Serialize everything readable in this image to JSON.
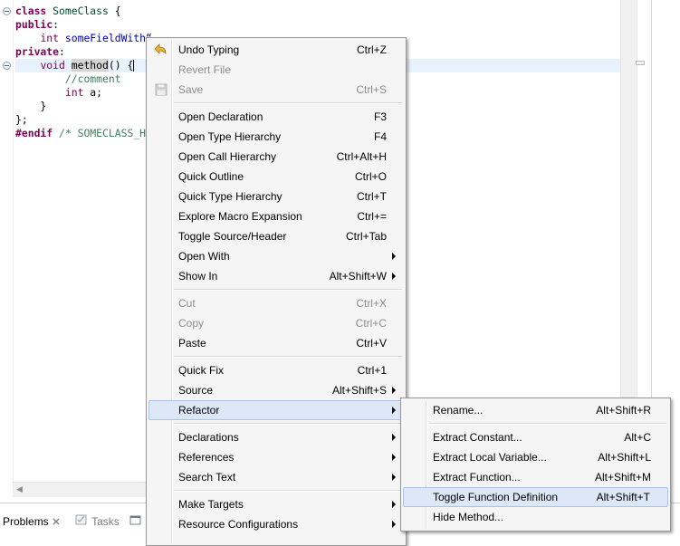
{
  "editor": {
    "lines": [
      {
        "parts": [
          [
            "kw",
            "class"
          ],
          [
            "",
            " "
          ],
          [
            "cls",
            "SomeClass"
          ],
          [
            "",
            " {"
          ]
        ]
      },
      {
        "parts": [
          [
            "kw",
            "public"
          ],
          [
            "",
            ":"
          ]
        ]
      },
      {
        "parts": [
          [
            "",
            "    "
          ],
          [
            "ty",
            "int"
          ],
          [
            "",
            " "
          ],
          [
            "fld",
            "someFieldWith“"
          ]
        ]
      },
      {
        "parts": [
          [
            "kw",
            "private"
          ],
          [
            "",
            ":"
          ]
        ]
      },
      {
        "parts": [
          [
            "",
            "    "
          ],
          [
            "ty",
            "void"
          ],
          [
            "",
            " "
          ],
          [
            "method",
            "method"
          ],
          [
            "",
            "() {"
          ]
        ]
      },
      {
        "parts": [
          [
            "",
            "        "
          ],
          [
            "cm",
            "//comment"
          ]
        ]
      },
      {
        "parts": [
          [
            "",
            "        "
          ],
          [
            "ty",
            "int"
          ],
          [
            "",
            " a;"
          ]
        ]
      },
      {
        "parts": [
          [
            "",
            "    }"
          ]
        ]
      },
      {
        "parts": [
          [
            "",
            "};"
          ]
        ]
      },
      {
        "parts": [
          [
            "pp",
            "#endif"
          ],
          [
            "",
            " "
          ],
          [
            "cm",
            "/* SOMECLASS_H"
          ]
        ]
      }
    ]
  },
  "bottom_panel": {
    "tabs": [
      {
        "label": "Problems",
        "icon": "problems-icon",
        "active": true
      },
      {
        "label": "Tasks",
        "icon": "tasks-icon",
        "active": false
      },
      {
        "label": "",
        "icon": "console-icon",
        "active": false
      }
    ]
  },
  "context_menu": {
    "items": [
      {
        "type": "item",
        "label": "Undo Typing",
        "shortcut": "Ctrl+Z",
        "icon": "undo-icon",
        "enabled": true
      },
      {
        "type": "item",
        "label": "Revert File",
        "shortcut": "",
        "enabled": false
      },
      {
        "type": "item",
        "label": "Save",
        "shortcut": "Ctrl+S",
        "icon": "save-icon",
        "enabled": false
      },
      {
        "type": "sep"
      },
      {
        "type": "item",
        "label": "Open Declaration",
        "shortcut": "F3",
        "enabled": true
      },
      {
        "type": "item",
        "label": "Open Type Hierarchy",
        "shortcut": "F4",
        "enabled": true
      },
      {
        "type": "item",
        "label": "Open Call Hierarchy",
        "shortcut": "Ctrl+Alt+H",
        "enabled": true
      },
      {
        "type": "item",
        "label": "Quick Outline",
        "shortcut": "Ctrl+O",
        "enabled": true
      },
      {
        "type": "item",
        "label": "Quick Type Hierarchy",
        "shortcut": "Ctrl+T",
        "enabled": true
      },
      {
        "type": "item",
        "label": "Explore Macro Expansion",
        "shortcut": "Ctrl+=",
        "enabled": true
      },
      {
        "type": "item",
        "label": "Toggle Source/Header",
        "shortcut": "Ctrl+Tab",
        "enabled": true
      },
      {
        "type": "item",
        "label": "Open With",
        "shortcut": "",
        "submenu": true,
        "enabled": true
      },
      {
        "type": "item",
        "label": "Show In",
        "shortcut": "Alt+Shift+W",
        "submenu": true,
        "enabled": true
      },
      {
        "type": "sep"
      },
      {
        "type": "item",
        "label": "Cut",
        "shortcut": "Ctrl+X",
        "enabled": false
      },
      {
        "type": "item",
        "label": "Copy",
        "shortcut": "Ctrl+C",
        "enabled": false
      },
      {
        "type": "item",
        "label": "Paste",
        "shortcut": "Ctrl+V",
        "enabled": true
      },
      {
        "type": "sep"
      },
      {
        "type": "item",
        "label": "Quick Fix",
        "shortcut": "Ctrl+1",
        "enabled": true
      },
      {
        "type": "item",
        "label": "Source",
        "shortcut": "Alt+Shift+S",
        "submenu": true,
        "enabled": true
      },
      {
        "type": "item",
        "label": "Refactor",
        "shortcut": "",
        "submenu": true,
        "enabled": true,
        "selected": true
      },
      {
        "type": "sep"
      },
      {
        "type": "item",
        "label": "Declarations",
        "shortcut": "",
        "submenu": true,
        "enabled": true
      },
      {
        "type": "item",
        "label": "References",
        "shortcut": "",
        "submenu": true,
        "enabled": true
      },
      {
        "type": "item",
        "label": "Search Text",
        "shortcut": "",
        "submenu": true,
        "enabled": true
      },
      {
        "type": "sep"
      },
      {
        "type": "item",
        "label": "Make Targets",
        "shortcut": "",
        "submenu": true,
        "enabled": true
      },
      {
        "type": "item",
        "label": "Resource Configurations",
        "shortcut": "",
        "submenu": true,
        "enabled": true
      }
    ]
  },
  "refactor_submenu": {
    "items": [
      {
        "type": "item",
        "label": "Rename...",
        "shortcut": "Alt+Shift+R"
      },
      {
        "type": "sep"
      },
      {
        "type": "item",
        "label": "Extract Constant...",
        "shortcut": "Alt+C"
      },
      {
        "type": "item",
        "label": "Extract Local Variable...",
        "shortcut": "Alt+Shift+L"
      },
      {
        "type": "item",
        "label": "Extract Function...",
        "shortcut": "Alt+Shift+M"
      },
      {
        "type": "item",
        "label": "Toggle Function Definition",
        "shortcut": "Alt+Shift+T",
        "selected": true
      },
      {
        "type": "item",
        "label": "Hide Method...",
        "shortcut": ""
      }
    ]
  },
  "colors": {
    "keyword": "#7f0055",
    "field": "#0000c0",
    "comment": "#3f7f5f",
    "menu_bg": "#f5f5f5",
    "selection_bg": "#dce7f7",
    "current_line": "#e8f2fe"
  }
}
